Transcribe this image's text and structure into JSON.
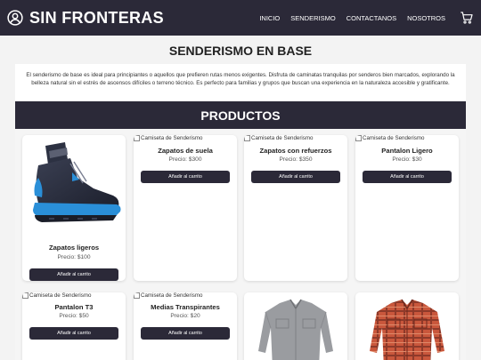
{
  "header": {
    "brand": "SIN FRONTERAS",
    "nav": [
      "INICIO",
      "SENDERISMO",
      "CONTACTANOS",
      "NOSOTROS"
    ]
  },
  "page": {
    "title": "SENDERISMO EN BASE",
    "intro": "El senderismo de base es ideal para principiantes o aquellos que prefieren rutas menos exigentes. Disfruta de caminatas tranquilas por senderos bien marcados, explorando la belleza natural sin el estrés de ascensos difíciles o terreno técnico. Es perfecto para familias y grupos que buscan una experiencia en la naturaleza accesible y gratificante.",
    "products_heading": "PRODUCTOS"
  },
  "products": [
    {
      "name": "Zapatos ligeros",
      "price": "Precio: $100",
      "button": "Añadir al carrito",
      "image": "shoe"
    },
    {
      "name": "Zapatos de suela",
      "price": "Precio: $300",
      "button": "Añadir al carrito",
      "image_alt": "Camiseta de Senderismo"
    },
    {
      "name": "Zapatos con refuerzos",
      "price": "Precio: $350",
      "button": "Añadir al carrito",
      "image_alt": "Camiseta de Senderismo"
    },
    {
      "name": "Pantalon Ligero",
      "price": "Precio: $30",
      "button": "Añadir al carrito",
      "image_alt": "Camiseta de Senderismo"
    },
    {
      "name": "Pantalon T3",
      "price": "Precio: $50",
      "button": "Añadir al carrito",
      "image_alt": "Camiseta de Senderismo"
    },
    {
      "name": "Medias Transpirantes",
      "price": "Precio: $20",
      "button": "Añadir al carrito",
      "image_alt": "Camiseta de Senderismo"
    },
    {
      "image": "grey-shirt"
    },
    {
      "image": "red-plaid-shirt"
    }
  ],
  "colors": {
    "header_bg": "#2b2938",
    "button_bg": "#2b2938",
    "accent_blue": "#2a8fd8"
  },
  "icons": {
    "brand": "user-circle-icon",
    "cart": "shopping-cart-icon"
  }
}
